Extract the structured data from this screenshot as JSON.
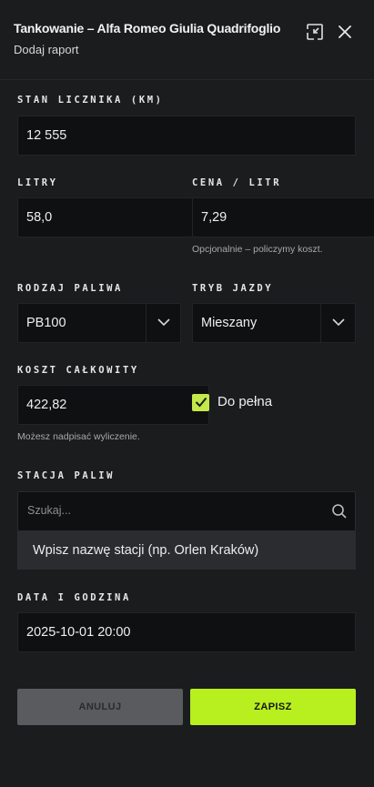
{
  "header": {
    "title": "Tankowanie – Alfa Romeo Giulia Quadrifoglio",
    "subtitle": "Dodaj raport"
  },
  "odometer": {
    "label": "STAN LICZNIKA (KM)",
    "value": "12 555"
  },
  "liters": {
    "label": "LITRY",
    "value": "58,0"
  },
  "price": {
    "label": "CENA / LITR",
    "value": "7,29",
    "hint": "Opcjonalnie – policzymy koszt."
  },
  "fuel_type": {
    "label": "RODZAJ PALIWA",
    "value": "PB100"
  },
  "drive_mode": {
    "label": "TRYB JAZDY",
    "value": "Mieszany"
  },
  "total_cost": {
    "label": "KOSZT CAŁKOWITY",
    "value": "422,82",
    "hint": "Możesz nadpisać wyliczenie."
  },
  "full_tank": {
    "label": "Do pełna",
    "checked": true
  },
  "station": {
    "label": "STACJA PALIW",
    "placeholder": "Szukaj...",
    "suggestion": "Wpisz nazwę stacji (np. Orlen Kraków)"
  },
  "datetime": {
    "label": "DATA I GODZINA",
    "value": "2025-10-01 20:00"
  },
  "actions": {
    "cancel": "ANULUJ",
    "save": "ZAPISZ"
  },
  "colors": {
    "accent": "#b8ef1f",
    "background": "#1b1c1e",
    "field": "#0f1011"
  },
  "icons": {
    "minimize": "collapse-icon",
    "close": "close-icon",
    "search": "search-icon",
    "chevron": "chevron-down-icon",
    "check": "check-icon"
  }
}
